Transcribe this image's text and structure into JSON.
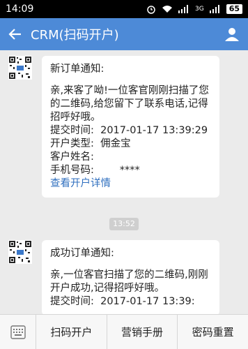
{
  "status_bar": {
    "time": "14:09",
    "network": "3G",
    "battery": "65"
  },
  "title_bar": {
    "title": "CRM(扫码开户)"
  },
  "messages": [
    {
      "head": "新订单通知:",
      "lines": [
        "亲,来客了呦!一位客官刚刚扫描了您的二维码,给您留下了联系电话,记得招呼好哦。",
        "提交时间:  2017-01-17 13:39:29",
        "开户类型:  佣金宝",
        "客户姓名:",
        "手机号码:        ****"
      ],
      "link": "查看开户详情"
    },
    {
      "head": "成功订单通知:",
      "lines": [
        "亲,一位客官扫描了您的二维码,刚刚开户成功,记得招呼好哦。",
        "提交时间:  2017-01-17 13:39:"
      ]
    }
  ],
  "time_divider": "13:52",
  "bottom_menu": {
    "items": [
      "扫码开户",
      "营销手册",
      "密码重置"
    ]
  },
  "icons": {
    "back": "back-arrow-icon",
    "user": "user-profile-icon",
    "keyboard": "keyboard-icon",
    "qr": "qr-code-avatar"
  },
  "colors": {
    "title_bar": "#4d8ad7",
    "link": "#2f6fbf"
  }
}
